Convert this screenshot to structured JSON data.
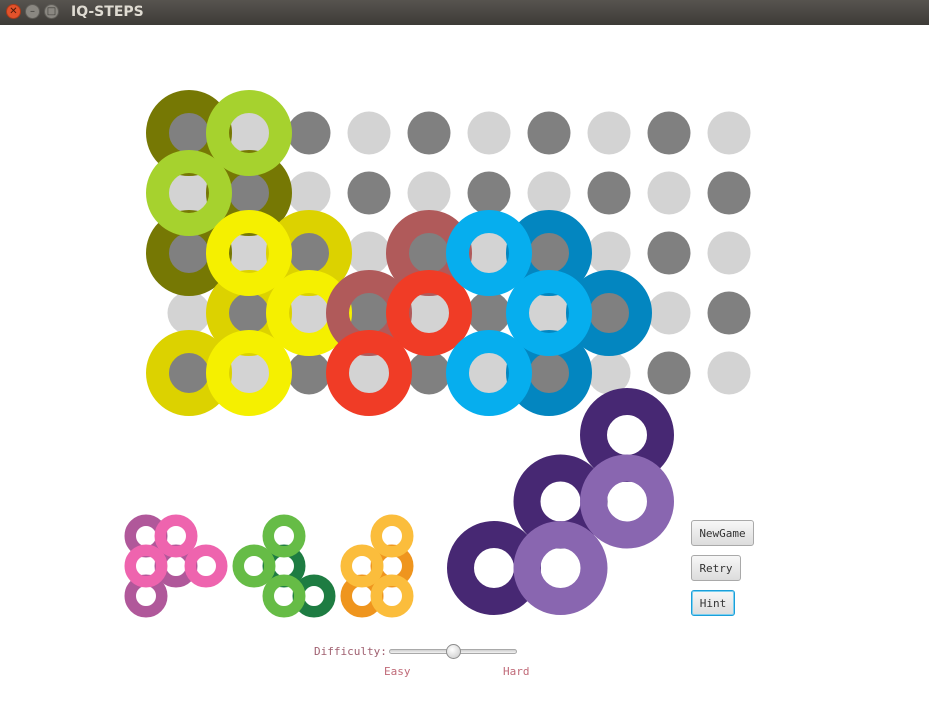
{
  "window": {
    "title": "IQ-STEPS"
  },
  "board": {
    "rows": 5,
    "cols": 10,
    "peg_light": "#d3d3d3",
    "peg_dark": "#808080",
    "placed_pieces": [
      {
        "color": "#767804",
        "rings": [
          [
            0,
            0
          ],
          [
            1,
            1
          ],
          [
            0,
            2
          ]
        ]
      },
      {
        "color": "#a6d22e",
        "rings": [
          [
            1,
            0
          ],
          [
            0,
            1
          ]
        ]
      },
      {
        "color": "#dcd200",
        "rings": [
          [
            2,
            2
          ],
          [
            1,
            3
          ],
          [
            0,
            4
          ]
        ]
      },
      {
        "color": "#f5f000",
        "rings": [
          [
            1,
            2
          ],
          [
            2,
            3
          ],
          [
            1,
            4
          ]
        ]
      },
      {
        "color": "#b05a5a",
        "rings": [
          [
            4,
            2
          ],
          [
            3,
            3
          ]
        ]
      },
      {
        "color": "#f03c26",
        "rings": [
          [
            4,
            3
          ],
          [
            3,
            4
          ]
        ]
      },
      {
        "color": "#0386c0",
        "rings": [
          [
            6,
            2
          ],
          [
            7,
            3
          ],
          [
            6,
            4
          ]
        ]
      },
      {
        "color": "#06aeee",
        "rings": [
          [
            5,
            2
          ],
          [
            6,
            3
          ],
          [
            5,
            4
          ]
        ]
      }
    ]
  },
  "tray": [
    {
      "color": "#b0589a",
      "rings": [
        [
          0,
          0
        ],
        [
          1,
          1
        ],
        [
          0,
          2
        ]
      ]
    },
    {
      "color": "#ee64ae",
      "rings": [
        [
          1,
          0
        ],
        [
          0,
          1
        ],
        [
          2,
          1
        ]
      ]
    },
    {
      "color": "#1e7c42",
      "rings": [
        [
          1,
          1
        ],
        [
          2,
          2
        ]
      ]
    },
    {
      "color": "#66bc46",
      "rings": [
        [
          1,
          0
        ],
        [
          0,
          1
        ],
        [
          1,
          2
        ]
      ]
    },
    {
      "color": "#ef951e",
      "rings": [
        [
          1,
          1
        ],
        [
          0,
          2
        ]
      ]
    },
    {
      "color": "#fbbd3c",
      "rings": [
        [
          1,
          0
        ],
        [
          0,
          1
        ],
        [
          1,
          2
        ]
      ]
    },
    {
      "color": "#472873",
      "rings": [
        [
          2,
          0
        ],
        [
          1,
          1
        ],
        [
          0,
          2
        ]
      ]
    },
    {
      "color": "#8966b0",
      "rings": [
        [
          2,
          1
        ],
        [
          1,
          2
        ]
      ]
    }
  ],
  "controls": {
    "new_game": "NewGame",
    "retry": "Retry",
    "hint": "Hint",
    "difficulty_label": "Difficulty:",
    "easy": "Easy",
    "hard": "Hard",
    "difficulty_value": 0.5
  }
}
